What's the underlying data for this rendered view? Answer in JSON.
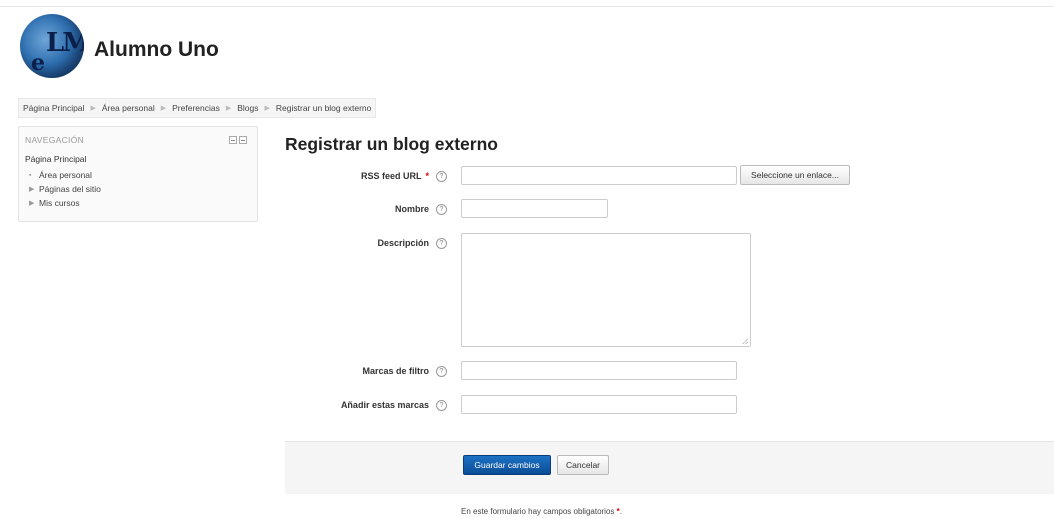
{
  "header": {
    "site_title": "Alumno Uno",
    "logo": {
      "icon": "elm-logo-icon",
      "letters_top": "LM",
      "letter_e": "e"
    }
  },
  "breadcrumb": [
    "Página Principal",
    "Área personal",
    "Preferencias",
    "Blogs",
    "Registrar un blog externo"
  ],
  "navigation": {
    "heading": "NAVEGACIÓN",
    "home": "Página Principal",
    "items": [
      {
        "bullet": "▪",
        "label": "Área personal"
      },
      {
        "bullet": "▶",
        "label": "Páginas del sitio"
      },
      {
        "bullet": "▶",
        "label": "Mis cursos"
      }
    ]
  },
  "form": {
    "title": "Registrar un blog externo",
    "rss_label": "RSS feed URL",
    "rss_value": "",
    "select_link_button": "Seleccione un enlace...",
    "name_label": "Nombre",
    "name_value": "",
    "description_label": "Descripción",
    "description_value": "",
    "filter_tags_label": "Marcas de filtro",
    "filter_tags_value": "",
    "add_tags_label": "Añadir estas marcas",
    "add_tags_value": "",
    "save_button": "Guardar cambios",
    "cancel_button": "Cancelar",
    "required_note": "En este formulario hay campos obligatorios",
    "required_mark": "*"
  },
  "colors": {
    "primary_button": "#0a4c95",
    "required": "#dd0000"
  }
}
